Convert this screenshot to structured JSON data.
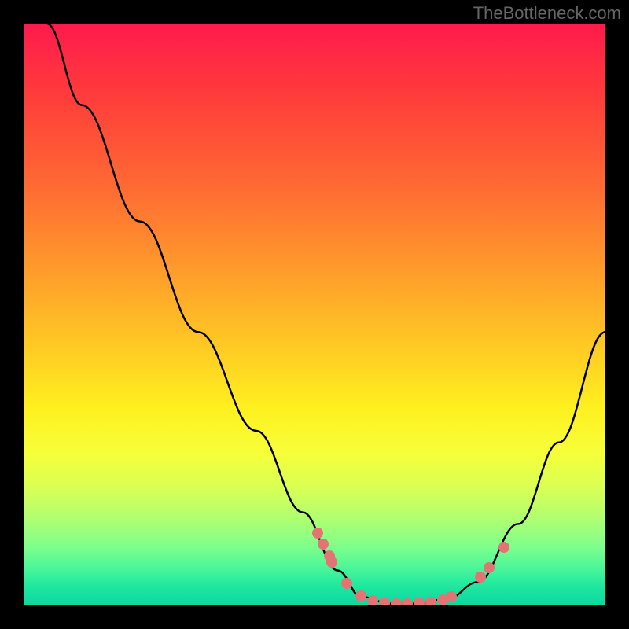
{
  "attribution": "TheBottleneck.com",
  "colors": {
    "background": "#000000",
    "attribution_text": "#666666",
    "curve_stroke": "#000000",
    "dot_fill": "#e57373",
    "gradient_stops": [
      {
        "offset": 0,
        "color": "#ff1a4d"
      },
      {
        "offset": 12,
        "color": "#ff3b3b"
      },
      {
        "offset": 28,
        "color": "#ff6a33"
      },
      {
        "offset": 42,
        "color": "#ff9a2b"
      },
      {
        "offset": 55,
        "color": "#ffc824"
      },
      {
        "offset": 66,
        "color": "#fff01f"
      },
      {
        "offset": 74,
        "color": "#f6ff3a"
      },
      {
        "offset": 80,
        "color": "#d8ff55"
      },
      {
        "offset": 85,
        "color": "#b0ff70"
      },
      {
        "offset": 90,
        "color": "#7dff8c"
      },
      {
        "offset": 94,
        "color": "#44f59a"
      },
      {
        "offset": 97,
        "color": "#1be69f"
      },
      {
        "offset": 100,
        "color": "#0dd8a0"
      }
    ]
  },
  "chart_data": {
    "type": "line",
    "title": "",
    "xlabel": "",
    "ylabel": "",
    "xlim": [
      0,
      100
    ],
    "ylim": [
      0,
      100
    ],
    "series": [
      {
        "name": "curve",
        "points": [
          {
            "x": 4,
            "y": 100
          },
          {
            "x": 10,
            "y": 86
          },
          {
            "x": 20,
            "y": 66
          },
          {
            "x": 30,
            "y": 47
          },
          {
            "x": 40,
            "y": 30
          },
          {
            "x": 48,
            "y": 16
          },
          {
            "x": 54,
            "y": 6
          },
          {
            "x": 58,
            "y": 1.5
          },
          {
            "x": 63,
            "y": 0.3
          },
          {
            "x": 68,
            "y": 0.3
          },
          {
            "x": 73,
            "y": 1.2
          },
          {
            "x": 78,
            "y": 4
          },
          {
            "x": 85,
            "y": 14
          },
          {
            "x": 92,
            "y": 28
          },
          {
            "x": 100,
            "y": 47
          }
        ]
      }
    ],
    "scatter_points": [
      {
        "x": 50.5,
        "y": 12.5
      },
      {
        "x": 51.5,
        "y": 10.5
      },
      {
        "x": 52.5,
        "y": 8.5
      },
      {
        "x": 53.0,
        "y": 7.5
      },
      {
        "x": 55.5,
        "y": 3.8
      },
      {
        "x": 58.0,
        "y": 1.6
      },
      {
        "x": 60.0,
        "y": 0.8
      },
      {
        "x": 62.0,
        "y": 0.4
      },
      {
        "x": 64.0,
        "y": 0.3
      },
      {
        "x": 66.0,
        "y": 0.3
      },
      {
        "x": 68.0,
        "y": 0.4
      },
      {
        "x": 70.0,
        "y": 0.6
      },
      {
        "x": 72.0,
        "y": 1.0
      },
      {
        "x": 73.5,
        "y": 1.5
      },
      {
        "x": 78.5,
        "y": 4.8
      },
      {
        "x": 80.0,
        "y": 6.5
      },
      {
        "x": 82.5,
        "y": 10.0
      }
    ]
  }
}
